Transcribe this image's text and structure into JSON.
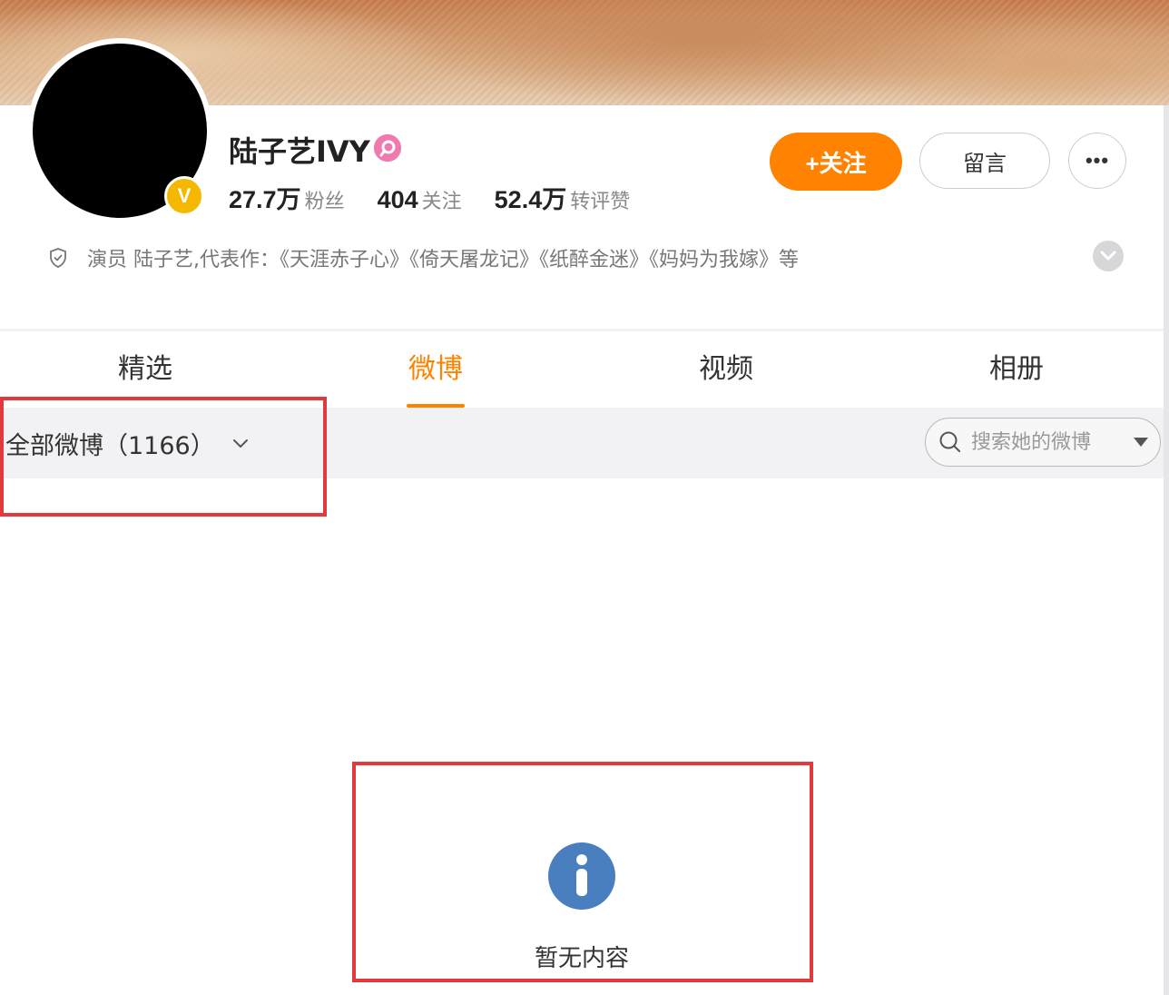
{
  "profile": {
    "name": "陆子艺IVY",
    "stats": [
      {
        "value": "27.7万",
        "label": "粉丝"
      },
      {
        "value": "404",
        "label": "关注"
      },
      {
        "value": "52.4万",
        "label": "转评赞"
      }
    ],
    "follow_label": "+关注",
    "message_label": "留言",
    "more_label": "•••",
    "bio": "演员 陆子艺,代表作：《天涯赤子心》《倚天屠龙记》《纸醉金迷》《妈妈为我嫁》等"
  },
  "tabs": [
    {
      "label": "精选"
    },
    {
      "label": "微博"
    },
    {
      "label": "视频"
    },
    {
      "label": "相册"
    }
  ],
  "active_tab": "微博",
  "filter": {
    "label": "全部微博（1166）"
  },
  "search": {
    "placeholder": "搜索她的微博"
  },
  "empty_state": {
    "text": "暂无内容"
  },
  "colors": {
    "accent": "#ff8200",
    "highlight": "#e03a3e",
    "info_icon": "#4a7fbf",
    "verified": "#f5b800"
  }
}
